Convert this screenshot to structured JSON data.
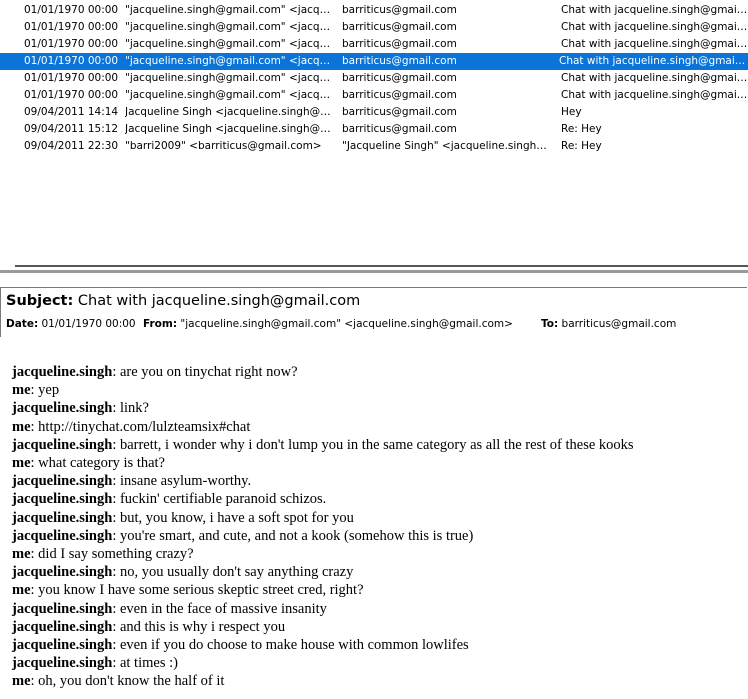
{
  "message_list": {
    "rows": [
      {
        "date": "01/01/1970 00:00",
        "from": "\"jacqueline.singh@gmail.com\" <jacquelin...",
        "to": "barriticus@gmail.com",
        "subject": "Chat with jacqueline.singh@gmail.com",
        "selected": false
      },
      {
        "date": "01/01/1970 00:00",
        "from": "\"jacqueline.singh@gmail.com\" <jacquelin...",
        "to": "barriticus@gmail.com",
        "subject": "Chat with jacqueline.singh@gmail.com",
        "selected": false
      },
      {
        "date": "01/01/1970 00:00",
        "from": "\"jacqueline.singh@gmail.com\" <jacquelin...",
        "to": "barriticus@gmail.com",
        "subject": "Chat with jacqueline.singh@gmail.com",
        "selected": false
      },
      {
        "date": "01/01/1970 00:00",
        "from": "\"jacqueline.singh@gmail.com\" <jacquelin...",
        "to": "barriticus@gmail.com",
        "subject": "Chat with jacqueline.singh@gmail.com",
        "selected": true
      },
      {
        "date": "01/01/1970 00:00",
        "from": "\"jacqueline.singh@gmail.com\" <jacquelin...",
        "to": "barriticus@gmail.com",
        "subject": "Chat with jacqueline.singh@gmail.com",
        "selected": false
      },
      {
        "date": "01/01/1970 00:00",
        "from": "\"jacqueline.singh@gmail.com\" <jacquelin...",
        "to": "barriticus@gmail.com",
        "subject": "Chat with jacqueline.singh@gmail.com",
        "selected": false
      },
      {
        "date": "09/04/2011 14:14",
        "from": "Jacqueline Singh <jacqueline.singh@gma...",
        "to": "barriticus@gmail.com",
        "subject": "Hey",
        "selected": false
      },
      {
        "date": "09/04/2011 15:12",
        "from": "Jacqueline Singh <jacqueline.singh@gma...",
        "to": "barriticus@gmail.com",
        "subject": "Re: Hey",
        "selected": false
      },
      {
        "date": "09/04/2011 22:30",
        "from": "\"barri2009\" <barriticus@gmail.com>",
        "to": "\"Jacqueline Singh\" <jacqueline.singh@g...",
        "subject": "Re: Hey",
        "selected": false
      }
    ]
  },
  "header": {
    "subject_label": "Subject:",
    "subject": "Chat with jacqueline.singh@gmail.com",
    "date_label": "Date:",
    "date": "01/01/1970 00:00",
    "from_label": "From:",
    "from": "\"jacqueline.singh@gmail.com\" <jacqueline.singh@gmail.com>",
    "to_label": "To:",
    "to": "barriticus@gmail.com"
  },
  "body": {
    "lines": [
      {
        "who": "jacqueline.singh",
        "text": ": are you on tinychat right now?"
      },
      {
        "who": "me",
        "text": ": yep"
      },
      {
        "who": "jacqueline.singh",
        "text": ": link?"
      },
      {
        "who": "me",
        "text": ": http://tinychat.com/lulzteamsix#chat"
      },
      {
        "who": "jacqueline.singh",
        "text": ": barrett, i wonder why i don't lump you in the same category as all the rest of these kooks"
      },
      {
        "who": "me",
        "text": ": what category is that?"
      },
      {
        "who": "jacqueline.singh",
        "text": ": insane asylum-worthy."
      },
      {
        "who": "jacqueline.singh",
        "text": ": fuckin' certifiable paranoid schizos."
      },
      {
        "who": "jacqueline.singh",
        "text": ": but, you know, i have a soft spot for you"
      },
      {
        "who": "jacqueline.singh",
        "text": ": you're smart, and cute, and not a kook (somehow this is true)"
      },
      {
        "who": "me",
        "text": ": did I say something crazy?"
      },
      {
        "who": "jacqueline.singh",
        "text": ": no, you usually don't say anything crazy"
      },
      {
        "who": "me",
        "text": ": you know I have some serious skeptic street cred, right?"
      },
      {
        "who": "jacqueline.singh",
        "text": ": even in the face of massive insanity"
      },
      {
        "who": "jacqueline.singh",
        "text": ": and this is why i respect you"
      },
      {
        "who": "jacqueline.singh",
        "text": ": even if you do choose to make house with common lowlifes"
      },
      {
        "who": "jacqueline.singh",
        "text": ": at times :)"
      },
      {
        "who": "me",
        "text": ": oh, you don't know the half of it"
      }
    ]
  },
  "colors": {
    "selection": "#0a74d8"
  }
}
